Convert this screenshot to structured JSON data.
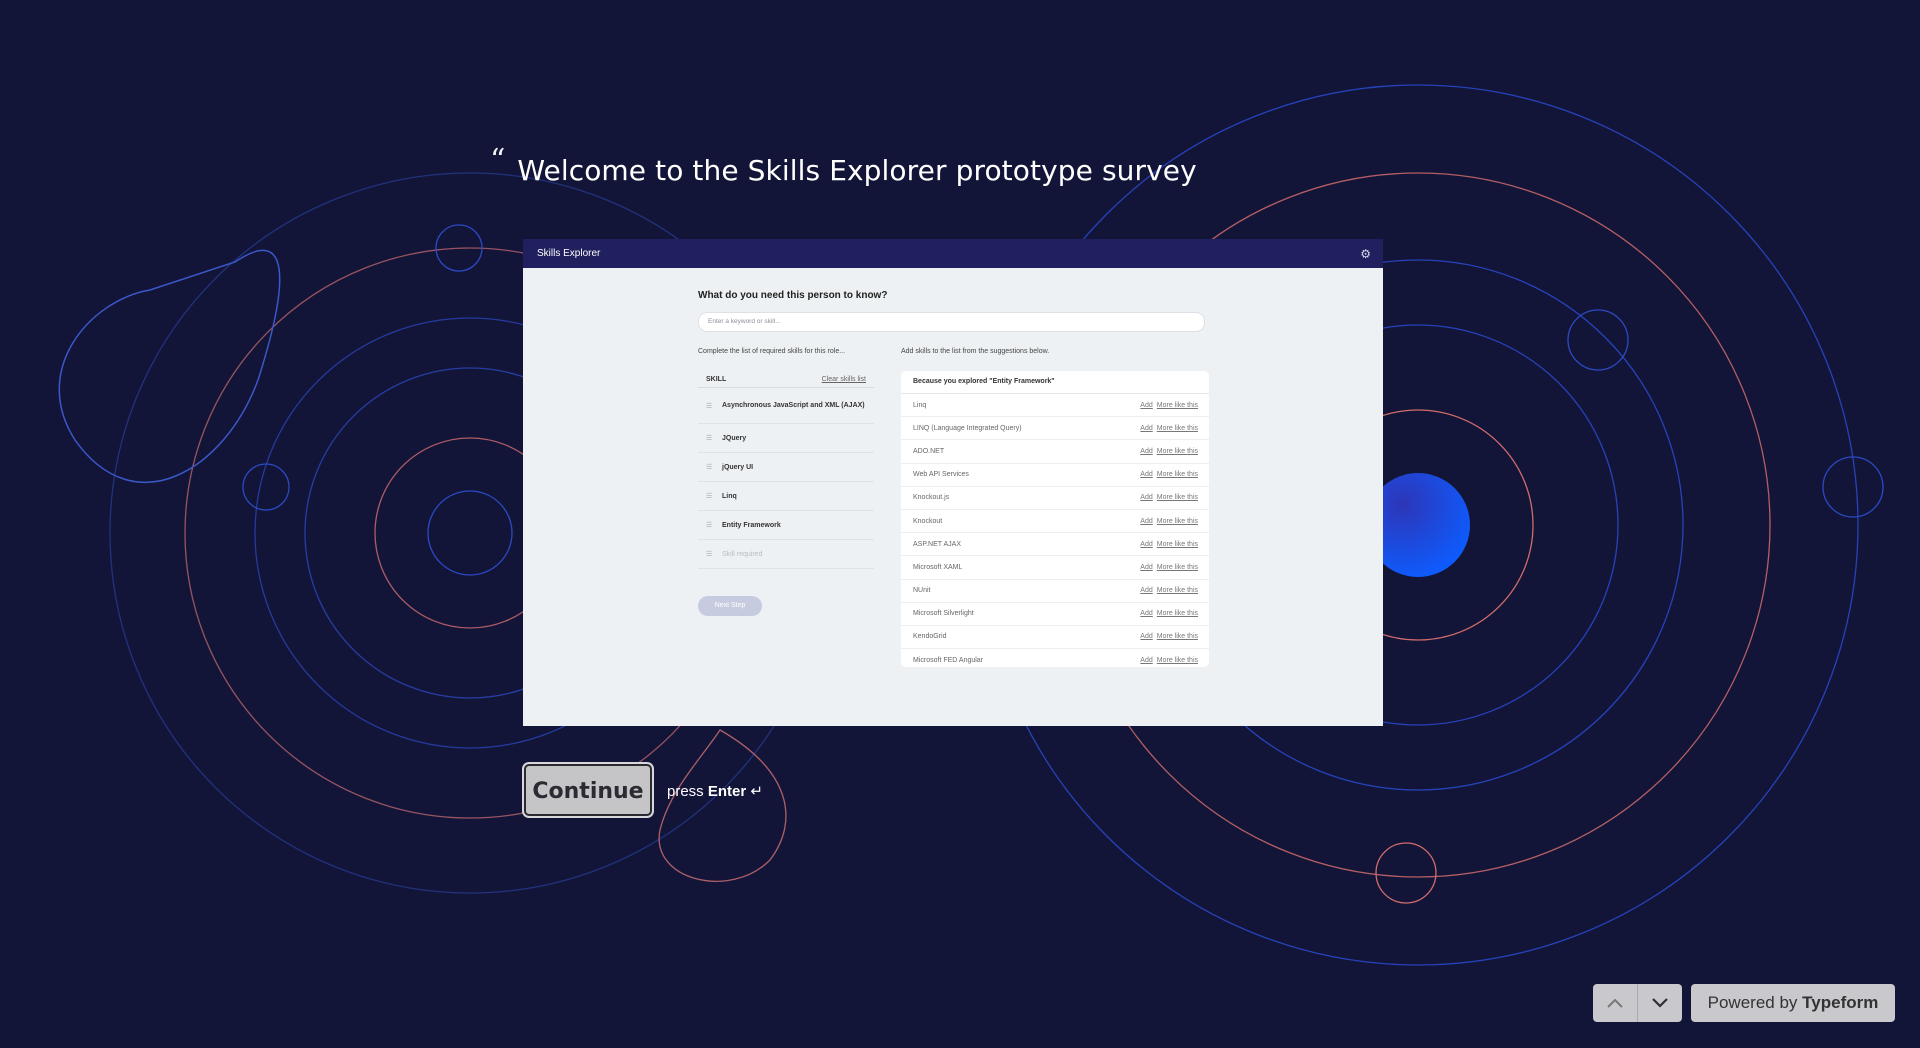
{
  "question": {
    "quote_mark": "“",
    "title": "Welcome to the Skills Explorer prototype survey"
  },
  "screenshot": {
    "app_title": "Skills Explorer",
    "prompt": "What do you need this person to know?",
    "search_placeholder": "Enter a keyword or skill...",
    "left_note": "Complete the list of required skills for this role...",
    "right_note": "Add skills to the list from the suggestions below.",
    "skill_header": "SKILL",
    "clear_label": "Clear skills list",
    "skills": [
      "Asynchronous JavaScript and XML (AJAX)",
      "JQuery",
      "jQuery UI",
      "Linq",
      "Entity Framework"
    ],
    "skill_placeholder": "Skill required",
    "next_label": "Next Step",
    "suggestions_header": "Because you explored \"Entity Framework\"",
    "add_label": "Add",
    "more_label": "More like this",
    "suggestions": [
      "Linq",
      "LINQ (Language Integrated Query)",
      "ADO.NET",
      "Web API Services",
      "Knockout.js",
      "Knockout",
      "ASP.NET AJAX",
      "Microsoft XAML",
      "NUnit",
      "Microsoft Silverlight",
      "KendoGrid",
      "Microsoft FED Angular"
    ]
  },
  "continue_label": "Continue",
  "press_hint": {
    "prefix": "press",
    "key": "Enter",
    "symbol": "↵"
  },
  "nav": {
    "up_icon": "chevron-up-icon",
    "down_icon": "chevron-down-icon"
  },
  "powered": {
    "prefix": "Powered by",
    "brand": "Typeform"
  },
  "colors": {
    "background": "#131538",
    "ring_blue": "#2a49c9",
    "ring_red": "#d96b6b",
    "orb": "#1f4cf0"
  }
}
